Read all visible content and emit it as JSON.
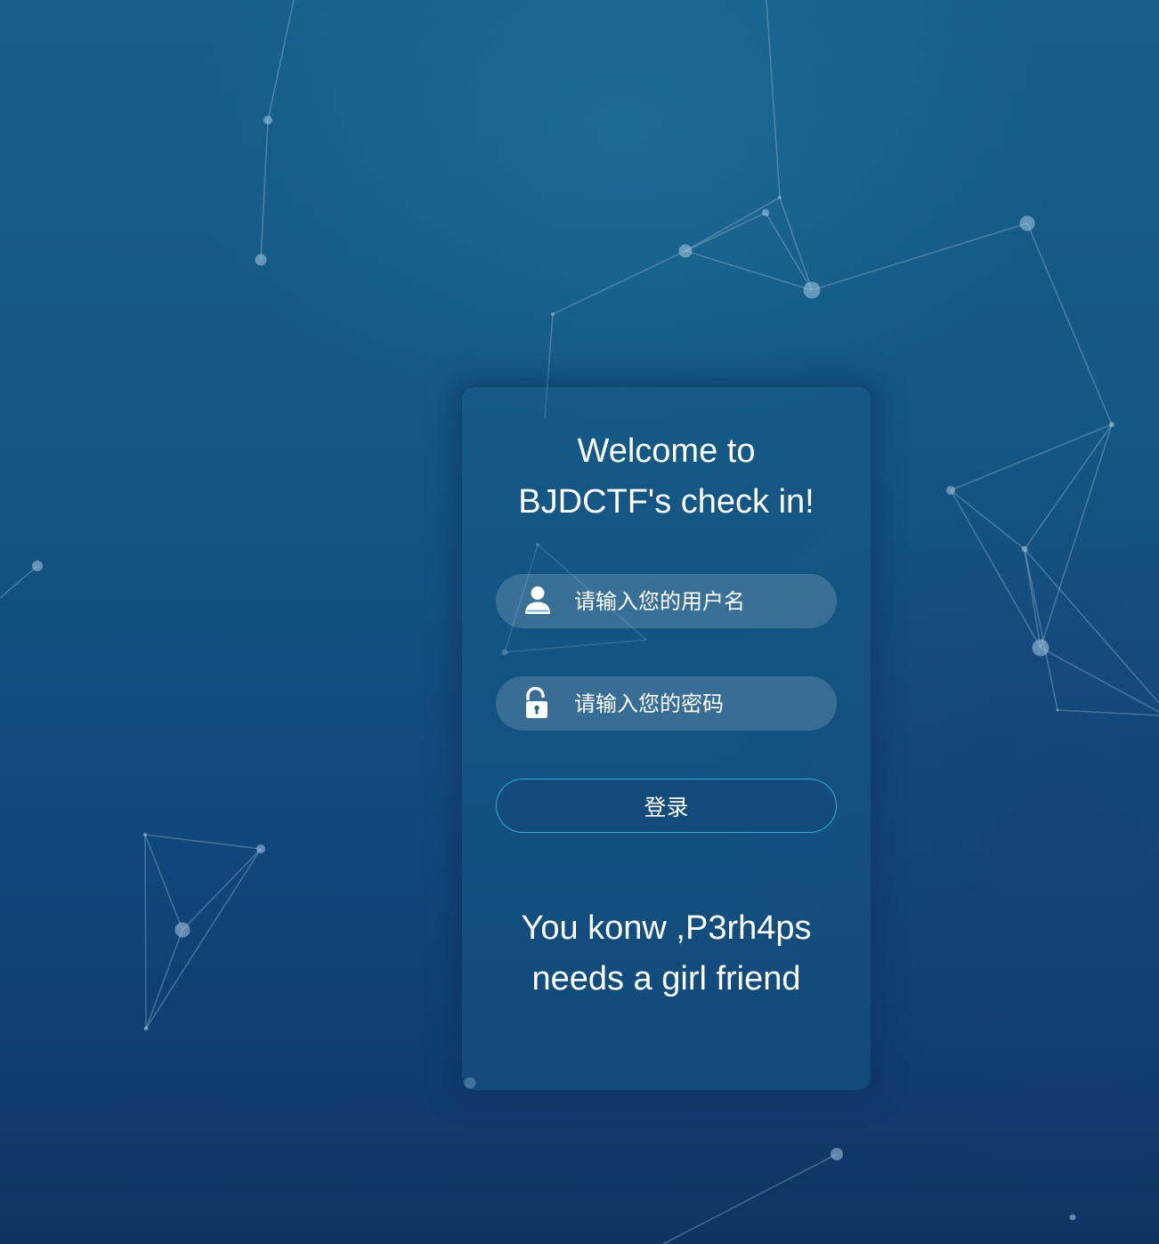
{
  "background": {
    "colors": {
      "top": "#175f8a",
      "bottom": "#0f3463"
    }
  },
  "card": {
    "title_line1": "Welcome to",
    "title_line2": "BJDCTF's check in!",
    "username_placeholder": "请输入您的用户名",
    "password_placeholder": "请输入您的密码",
    "login_label": "登录",
    "message_line1": "You konw ,P3rh4ps",
    "message_line2": "needs a girl friend",
    "colors": {
      "accent_border": "#27b1d9",
      "text": "#ffffff"
    },
    "icons": {
      "username": "user-icon",
      "password": "unlock-icon"
    }
  }
}
